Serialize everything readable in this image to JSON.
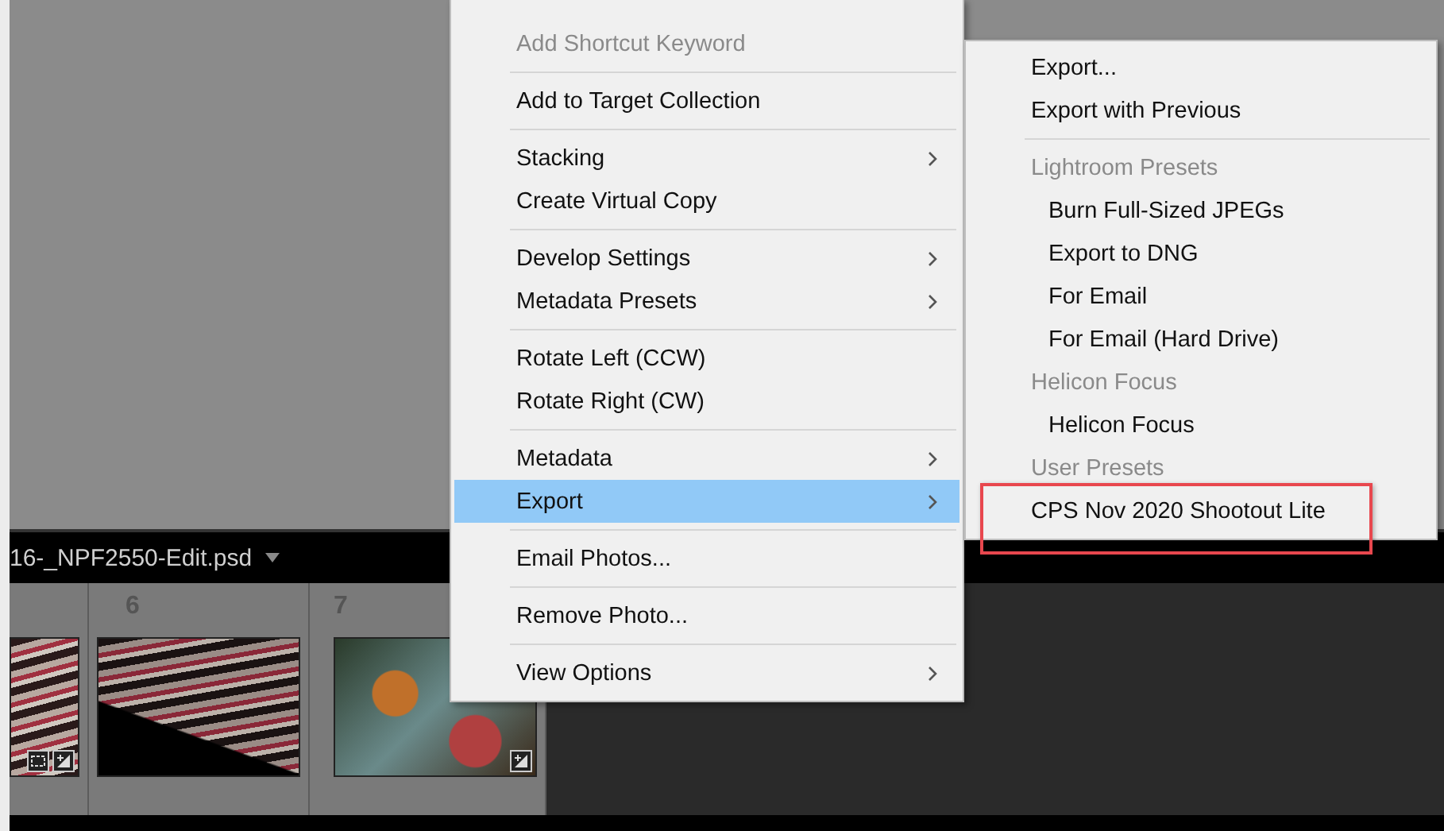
{
  "context_menu": {
    "items": [
      {
        "kind": "item",
        "label": "Add Shortcut Keyword",
        "disabled": true,
        "submenu": false,
        "selected": false
      },
      {
        "kind": "separator"
      },
      {
        "kind": "item",
        "label": "Add to Target Collection",
        "disabled": false,
        "submenu": false,
        "selected": false
      },
      {
        "kind": "separator"
      },
      {
        "kind": "item",
        "label": "Stacking",
        "disabled": false,
        "submenu": true,
        "selected": false
      },
      {
        "kind": "item",
        "label": "Create Virtual Copy",
        "disabled": false,
        "submenu": false,
        "selected": false
      },
      {
        "kind": "separator"
      },
      {
        "kind": "item",
        "label": "Develop Settings",
        "disabled": false,
        "submenu": true,
        "selected": false
      },
      {
        "kind": "item",
        "label": "Metadata Presets",
        "disabled": false,
        "submenu": true,
        "selected": false
      },
      {
        "kind": "separator"
      },
      {
        "kind": "item",
        "label": "Rotate Left (CCW)",
        "disabled": false,
        "submenu": false,
        "selected": false
      },
      {
        "kind": "item",
        "label": "Rotate Right (CW)",
        "disabled": false,
        "submenu": false,
        "selected": false
      },
      {
        "kind": "separator"
      },
      {
        "kind": "item",
        "label": "Metadata",
        "disabled": false,
        "submenu": true,
        "selected": false
      },
      {
        "kind": "item",
        "label": "Export",
        "disabled": false,
        "submenu": true,
        "selected": true
      },
      {
        "kind": "separator"
      },
      {
        "kind": "item",
        "label": "Email Photos...",
        "disabled": false,
        "submenu": false,
        "selected": false
      },
      {
        "kind": "separator"
      },
      {
        "kind": "item",
        "label": "Remove Photo...",
        "disabled": false,
        "submenu": false,
        "selected": false
      },
      {
        "kind": "separator"
      },
      {
        "kind": "item",
        "label": "View Options",
        "disabled": false,
        "submenu": true,
        "selected": false
      }
    ]
  },
  "export_submenu": {
    "items": [
      {
        "kind": "item",
        "label": "Export..."
      },
      {
        "kind": "item",
        "label": "Export with Previous"
      },
      {
        "kind": "separator"
      },
      {
        "kind": "heading",
        "label": "Lightroom Presets",
        "children": [
          {
            "label": "Burn Full-Sized JPEGs"
          },
          {
            "label": "Export to DNG"
          },
          {
            "label": "For Email"
          },
          {
            "label": "For Email (Hard Drive)"
          }
        ]
      },
      {
        "kind": "heading",
        "label": "Helicon Focus",
        "children": [
          {
            "label": "Helicon Focus"
          }
        ]
      },
      {
        "kind": "heading",
        "label": "User Presets",
        "children": [
          {
            "label": "CPS Nov 2020 Shootout Lite",
            "highlighted": true
          }
        ]
      }
    ]
  },
  "filmstrip": {
    "filename": "16-_NPF2550-Edit.psd",
    "cells": [
      {
        "kind": "cropped-edited"
      },
      {
        "number": "6",
        "kind": "plain"
      },
      {
        "number": "7",
        "kind": "edited"
      }
    ]
  }
}
